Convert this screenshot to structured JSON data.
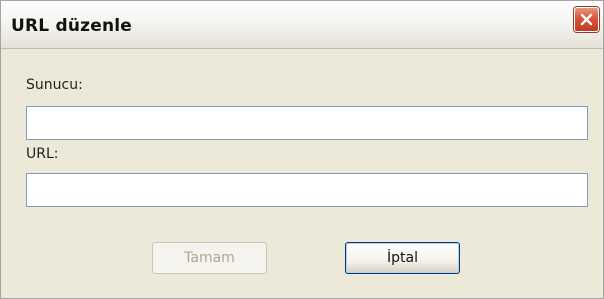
{
  "window": {
    "title": "URL düzenle",
    "close_icon": "close-icon"
  },
  "form": {
    "server_label": "Sunucu:",
    "server_value": "",
    "url_label": "URL:",
    "url_value": ""
  },
  "buttons": {
    "ok_label": "Tamam",
    "ok_enabled": false,
    "cancel_label": "İptal",
    "cancel_enabled": true
  },
  "colors": {
    "close_button": "#d6553c",
    "dialog_background": "#ece9d8",
    "textbox_border": "#7f9db9"
  }
}
